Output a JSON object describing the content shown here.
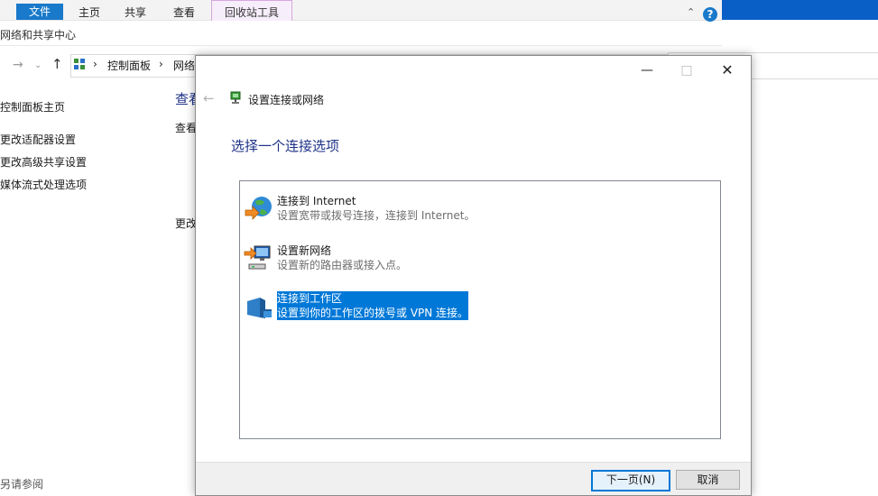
{
  "ribbon": {
    "tabs": [
      "文件",
      "主页",
      "共享",
      "查看"
    ],
    "tool_tab": "回收站工具"
  },
  "explorer": {
    "window_title": "网络和共享中心",
    "breadcrumb": [
      "控制面板",
      "网络"
    ],
    "sidebar": {
      "home": "控制面板主页",
      "links": [
        "更改适配器设置",
        "更改高级共享设置",
        "媒体流式处理选项"
      ],
      "see_also": "另请参阅"
    },
    "content_fragments": [
      "查看",
      "查看",
      "更改"
    ]
  },
  "dialog": {
    "title": "设置连接或网络",
    "heading": "选择一个连接选项",
    "options": [
      {
        "title": "连接到 Internet",
        "desc": "设置宽带或拨号连接，连接到 Internet。",
        "icon": "globe-icon"
      },
      {
        "title": "设置新网络",
        "desc": "设置新的路由器或接入点。",
        "icon": "router-monitor-icon"
      },
      {
        "title": "连接到工作区",
        "desc": "设置到你的工作区的拨号或 VPN 连接。",
        "icon": "workplace-icon"
      }
    ],
    "selected_index": 2,
    "buttons": {
      "next": "下一页(N)",
      "cancel": "取消"
    }
  },
  "colors": {
    "accent": "#0078d7",
    "heading": "#1e3287",
    "ribbon_file": "#1979ca"
  }
}
